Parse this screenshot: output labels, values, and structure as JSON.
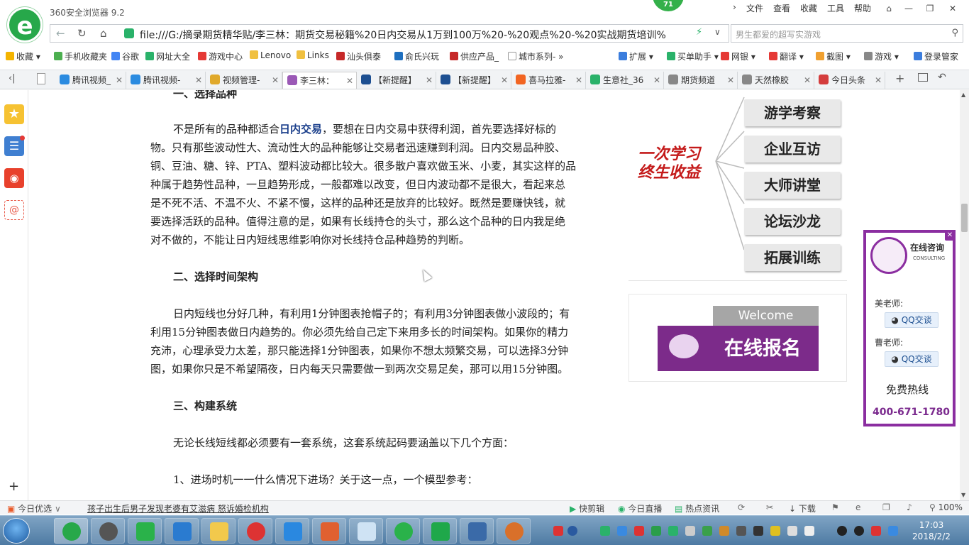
{
  "browser": {
    "app_title": "360安全浏览器 9.2",
    "badge_count": "71",
    "menu": [
      "文件",
      "查看",
      "收藏",
      "工具",
      "帮助"
    ],
    "address": "file:///G:/摘录期货精华贴/李三林：期货交易秘籍%20日内交易从1万到100万%20-%20观点%20-%20实战期货培训%",
    "search_placeholder": "男生都爱的超写实游戏"
  },
  "bookmarks": {
    "left": [
      "收藏",
      "手机收藏夹",
      "谷歌",
      "网址大全",
      "游戏中心",
      "Lenovo",
      "Links",
      "汕头俱泰",
      "俞氏兴玩",
      "供应产品_",
      "城市系列-"
    ],
    "right": [
      "扩展",
      "买单助手",
      "网银",
      "翻译",
      "截图",
      "游戏",
      "登录管家"
    ]
  },
  "tabs": [
    {
      "label": "腾讯视频_",
      "color": "#2b8be0"
    },
    {
      "label": "腾讯视频-",
      "color": "#2b8be0"
    },
    {
      "label": "视频管理-",
      "color": "#e0a92b"
    },
    {
      "label": "李三林：",
      "color": "#9b59b6"
    },
    {
      "label": "【新提醒】",
      "color": "#1d4f91"
    },
    {
      "label": "【新提醒】",
      "color": "#1d4f91"
    },
    {
      "label": "喜马拉雅-",
      "color": "#f26522"
    },
    {
      "label": "生意社_36",
      "color": "#2ab26a"
    },
    {
      "label": "期货频道",
      "color": "#888888"
    },
    {
      "label": "天然橡胶",
      "color": "#888888"
    },
    {
      "label": "今日头条",
      "color": "#d43d3d"
    }
  ],
  "article": {
    "heading1": "一、选择品种",
    "para1_before": "不是所有的品种都适合",
    "para1_link": "日内交易",
    "para1_after": "，要想在日内交易中获得利润，首先要选择好标的",
    "para1_lines": [
      "物。只有那些波动性大、流动性大的品种能够让交易者迅速赚到利润。日内交易品种胶、",
      "铜、豆油、糖、锌、PTA、塑料波动都比较大。很多散户喜欢做玉米、小麦，其实这样的品",
      "种属于趋势性品种，一旦趋势形成，一般都难以改变，但日内波动都不是很大，看起来总",
      "是不死不活、不温不火、不紧不慢，这样的品种还是放弃的比较好。既然是要赚快钱，就",
      "要选择活跃的品种。值得注意的是，如果有长线持仓的头寸，那么这个品种的日内我是绝",
      "对不做的，不能让日内短线思维影响你对长线持仓品种趋势的判断。"
    ],
    "heading2": "二、选择时间架构",
    "para2_first": "日内短线也分好几种，有利用1分钟图表抢帽子的；有利用3分钟图表做小波段的；有",
    "para2_lines": [
      "利用15分钟图表做日内趋势的。你必须先给自己定下来用多长的时间架构。如果你的精力",
      "充沛，心理承受力太差，那只能选择1分钟图表，如果你不想太频繁交易，可以选择3分钟",
      "图，如果你只是不希望隔夜，日内每天只需要做一到两次交易足矣，那可以用15分钟图。"
    ],
    "heading3": "三、构建系统",
    "para3": "无论长线短线都必须要有一套系统，这套系统起码要涵盖以下几个方面：",
    "para4": "1、进场时机一一什么情况下进场？关于这一点，一个模型参考："
  },
  "promo": {
    "slogan_line1": "一次学习",
    "slogan_line2": "终生收益",
    "items": [
      "游学考察",
      "企业互访",
      "大师讲堂",
      "论坛沙龙",
      "拓展训练"
    ],
    "welcome": "Welcome",
    "signup": "在线报名"
  },
  "consult": {
    "title": "在线咨询",
    "subtitle": "CONSULTING",
    "teacher1": "美老师:",
    "teacher2": "曹老师:",
    "qq_label": "QQ交谈",
    "hotline_label": "免费热线",
    "hotline": "400-671-1780"
  },
  "statusbar": {
    "left_label": "今日优选",
    "news": "孩子出生后男子发现老婆有艾滋病 怒诉婚检机构",
    "items": [
      "快剪辑",
      "今日直播",
      "热点资讯",
      "下载"
    ],
    "zoom": "100%"
  },
  "taskbar": {
    "time": "17:03",
    "date": "2018/2/2"
  }
}
